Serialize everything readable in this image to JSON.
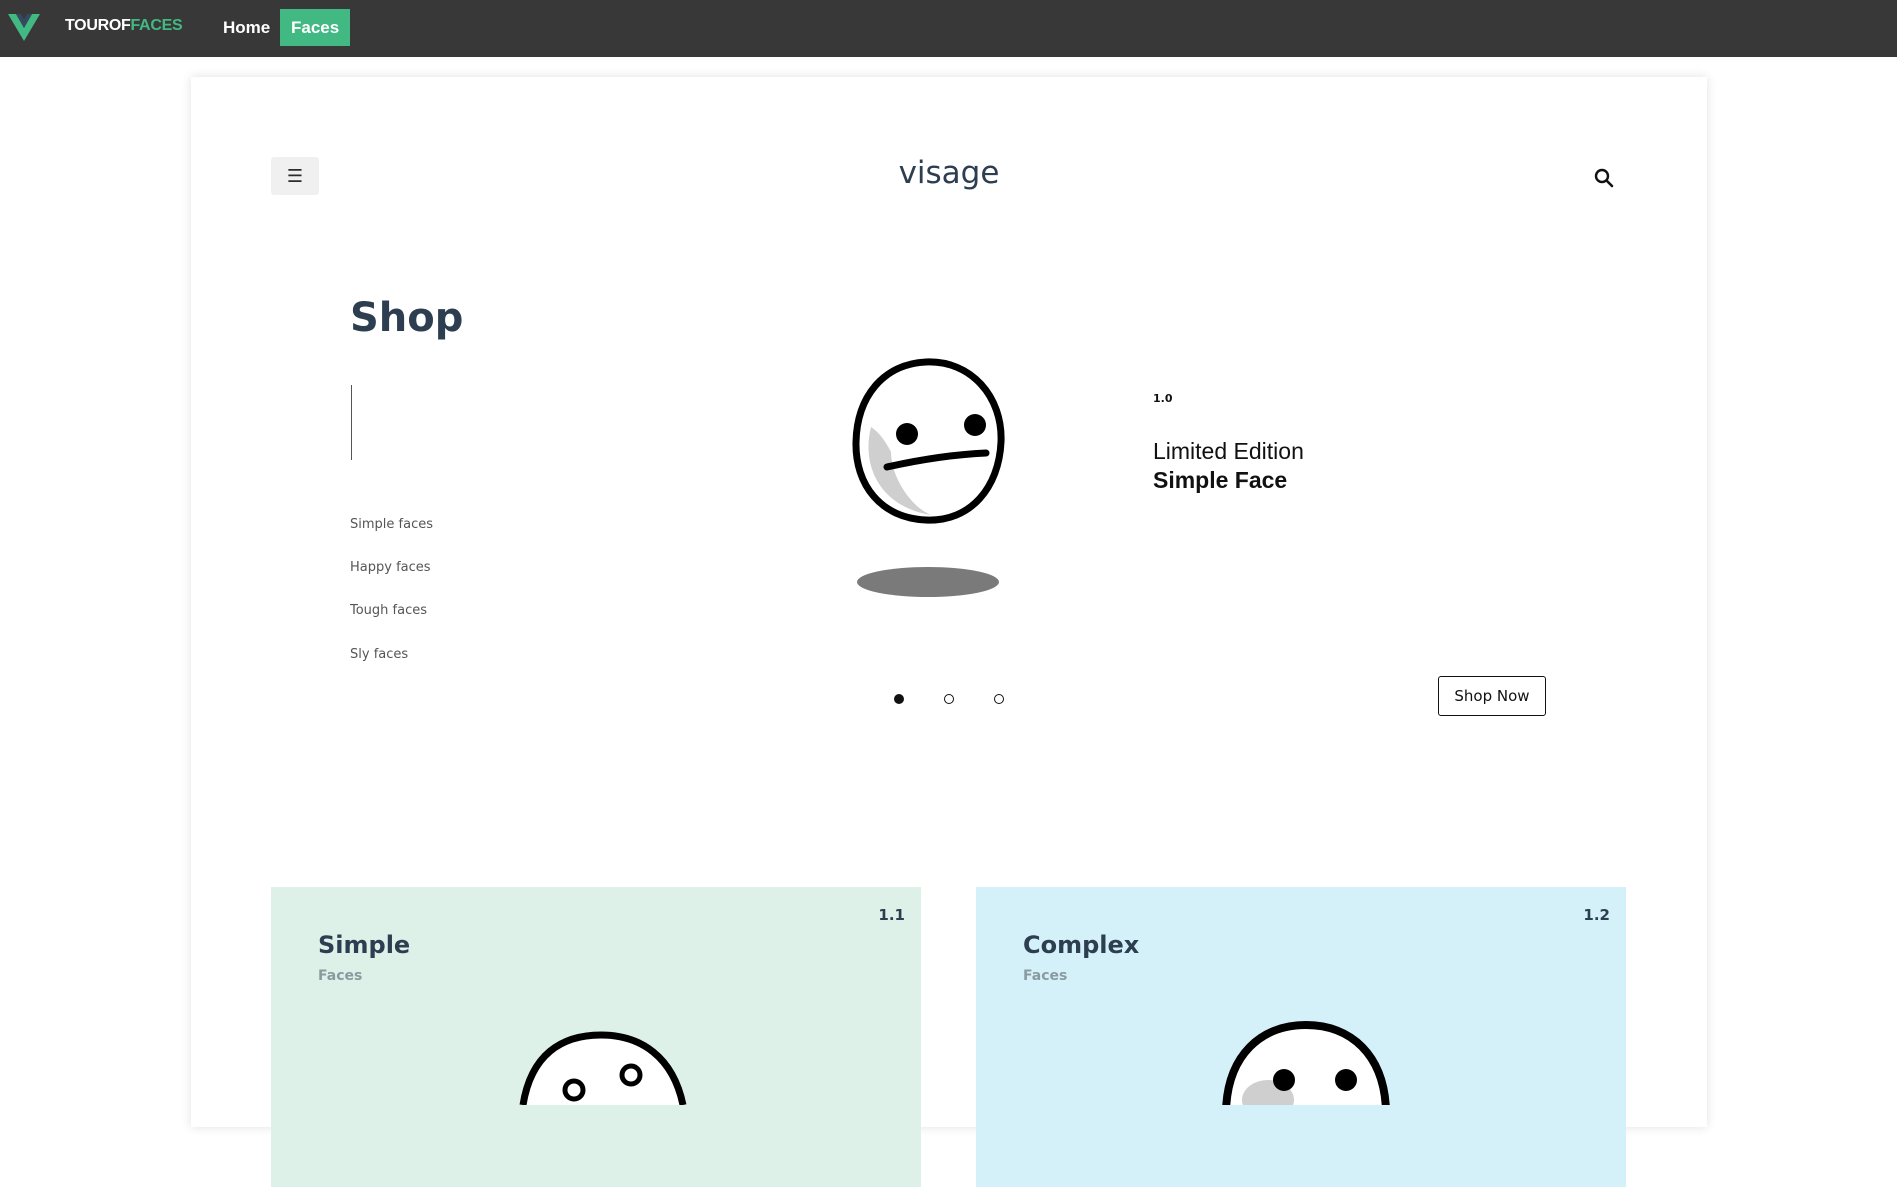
{
  "topnav": {
    "brand_tour": "TOUR",
    "brand_of": "OF",
    "brand_faces": "FACES",
    "links": [
      {
        "label": "Home",
        "active": false
      },
      {
        "label": "Faces",
        "active": true
      }
    ],
    "colors": {
      "bar": "#383838",
      "accent": "#42b883"
    }
  },
  "header": {
    "menu_icon": "☰",
    "title": "visage",
    "search_icon": "search-icon"
  },
  "hero": {
    "heading": "Shop",
    "categories": [
      "Simple faces",
      "Happy faces",
      "Tough faces",
      "Sly faces"
    ],
    "edition_number": "1.0",
    "edition_line1": "Limited Edition",
    "edition_line2": "Simple Face",
    "carousel": {
      "count": 3,
      "active_index": 0
    },
    "cta": "Shop Now"
  },
  "tiles": [
    {
      "number": "1.1",
      "title": "Simple",
      "subtitle": "Faces",
      "color": "#ddf1e8"
    },
    {
      "number": "1.2",
      "title": "Complex",
      "subtitle": "Faces",
      "color": "#d4f1f9"
    }
  ]
}
